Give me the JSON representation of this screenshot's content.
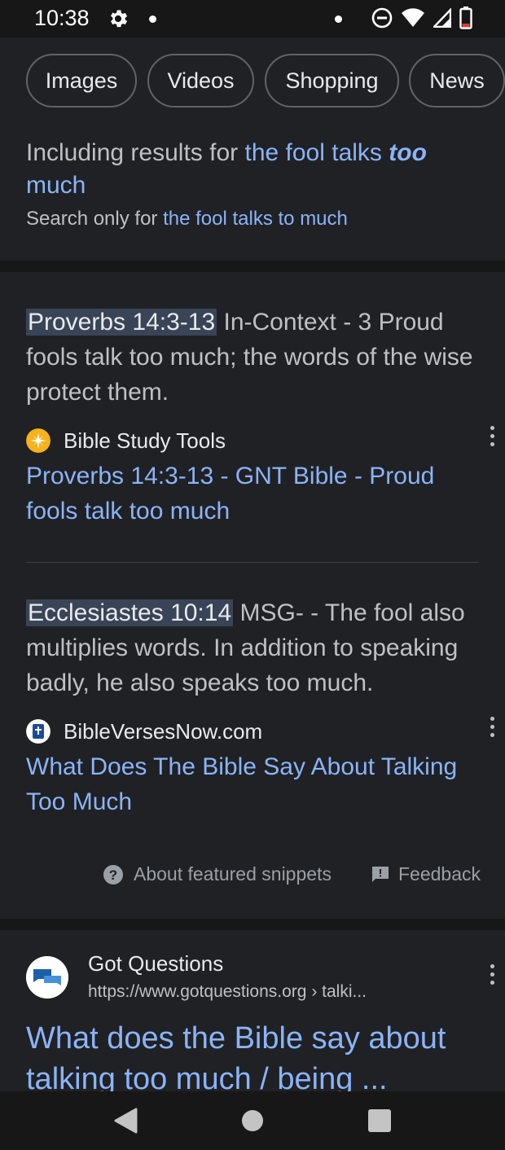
{
  "status": {
    "time": "10:38"
  },
  "chips": [
    "Images",
    "Videos",
    "Shopping",
    "News"
  ],
  "spelling": {
    "including_prefix": "Including results for",
    "corrected_query_main": "the fool talks",
    "corrected_query_emph": "too",
    "corrected_query_end": "much",
    "search_only_prefix": "Search only for",
    "original_query": "the fool talks to much"
  },
  "snippets": [
    {
      "highlight": "Proverbs 14:3-13",
      "text": "In-Context - 3 Proud fools talk too much; the words of the wise protect them.",
      "source": "Bible Study Tools",
      "link": "Proverbs 14:3-13 - GNT Bible - Proud fools talk too much"
    },
    {
      "highlight": "Ecclesiastes 10:14",
      "text": "MSG- - The fool also multiplies words. In addition to speaking badly, he also speaks too much.",
      "source": "BibleVersesNow.com",
      "link": "What Does The Bible Say About Talking Too Much"
    }
  ],
  "footer": {
    "about": "About featured snippets",
    "feedback": "Feedback"
  },
  "result": {
    "site": "Got Questions",
    "url": "https://www.gotquestions.org › talki...",
    "title": "What does the Bible say about talking too much / being ..."
  },
  "colors": {
    "link": "#8ab4f8",
    "highlight": "#394457",
    "bg": "#202124"
  }
}
